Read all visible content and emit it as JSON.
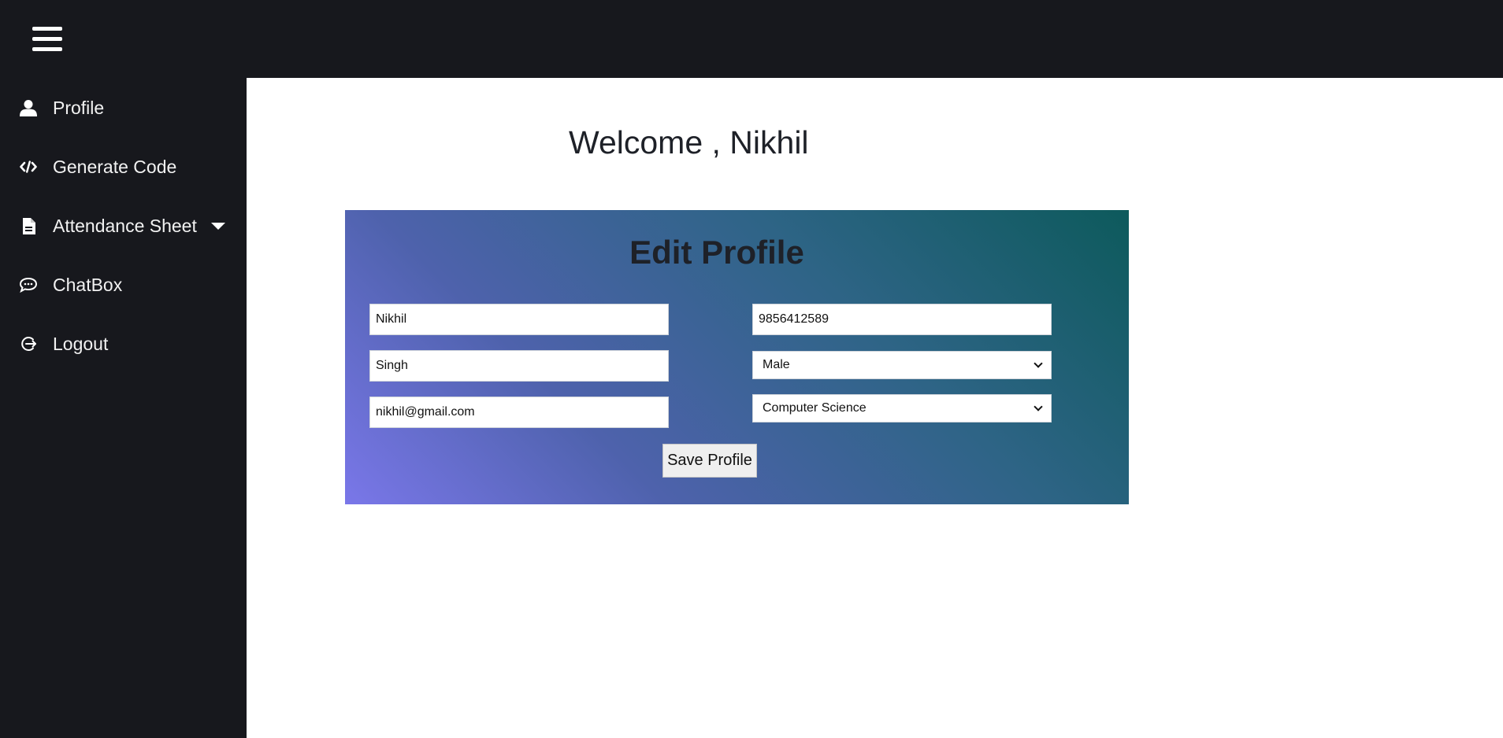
{
  "header": {
    "menu_icon": "hamburger-icon"
  },
  "sidebar": {
    "items": [
      {
        "label": "Profile",
        "icon": "user-icon"
      },
      {
        "label": "Generate Code",
        "icon": "code-icon"
      },
      {
        "label": "Attendance Sheet",
        "icon": "document-icon",
        "has_dropdown": true
      },
      {
        "label": "ChatBox",
        "icon": "chat-icon"
      },
      {
        "label": "Logout",
        "icon": "logout-icon"
      }
    ]
  },
  "main": {
    "welcome_text": "Welcome , Nikhil"
  },
  "form": {
    "title": "Edit Profile",
    "first_name": "Nikhil",
    "last_name": "Singh",
    "email": "nikhil@gmail.com",
    "phone": "9856412589",
    "gender": "Male",
    "department": "Computer Science",
    "save_label": "Save Profile"
  },
  "colors": {
    "sidebar_bg": "#17181d",
    "gradient_start": "#0d5a5c",
    "gradient_end": "#7a77e9"
  }
}
